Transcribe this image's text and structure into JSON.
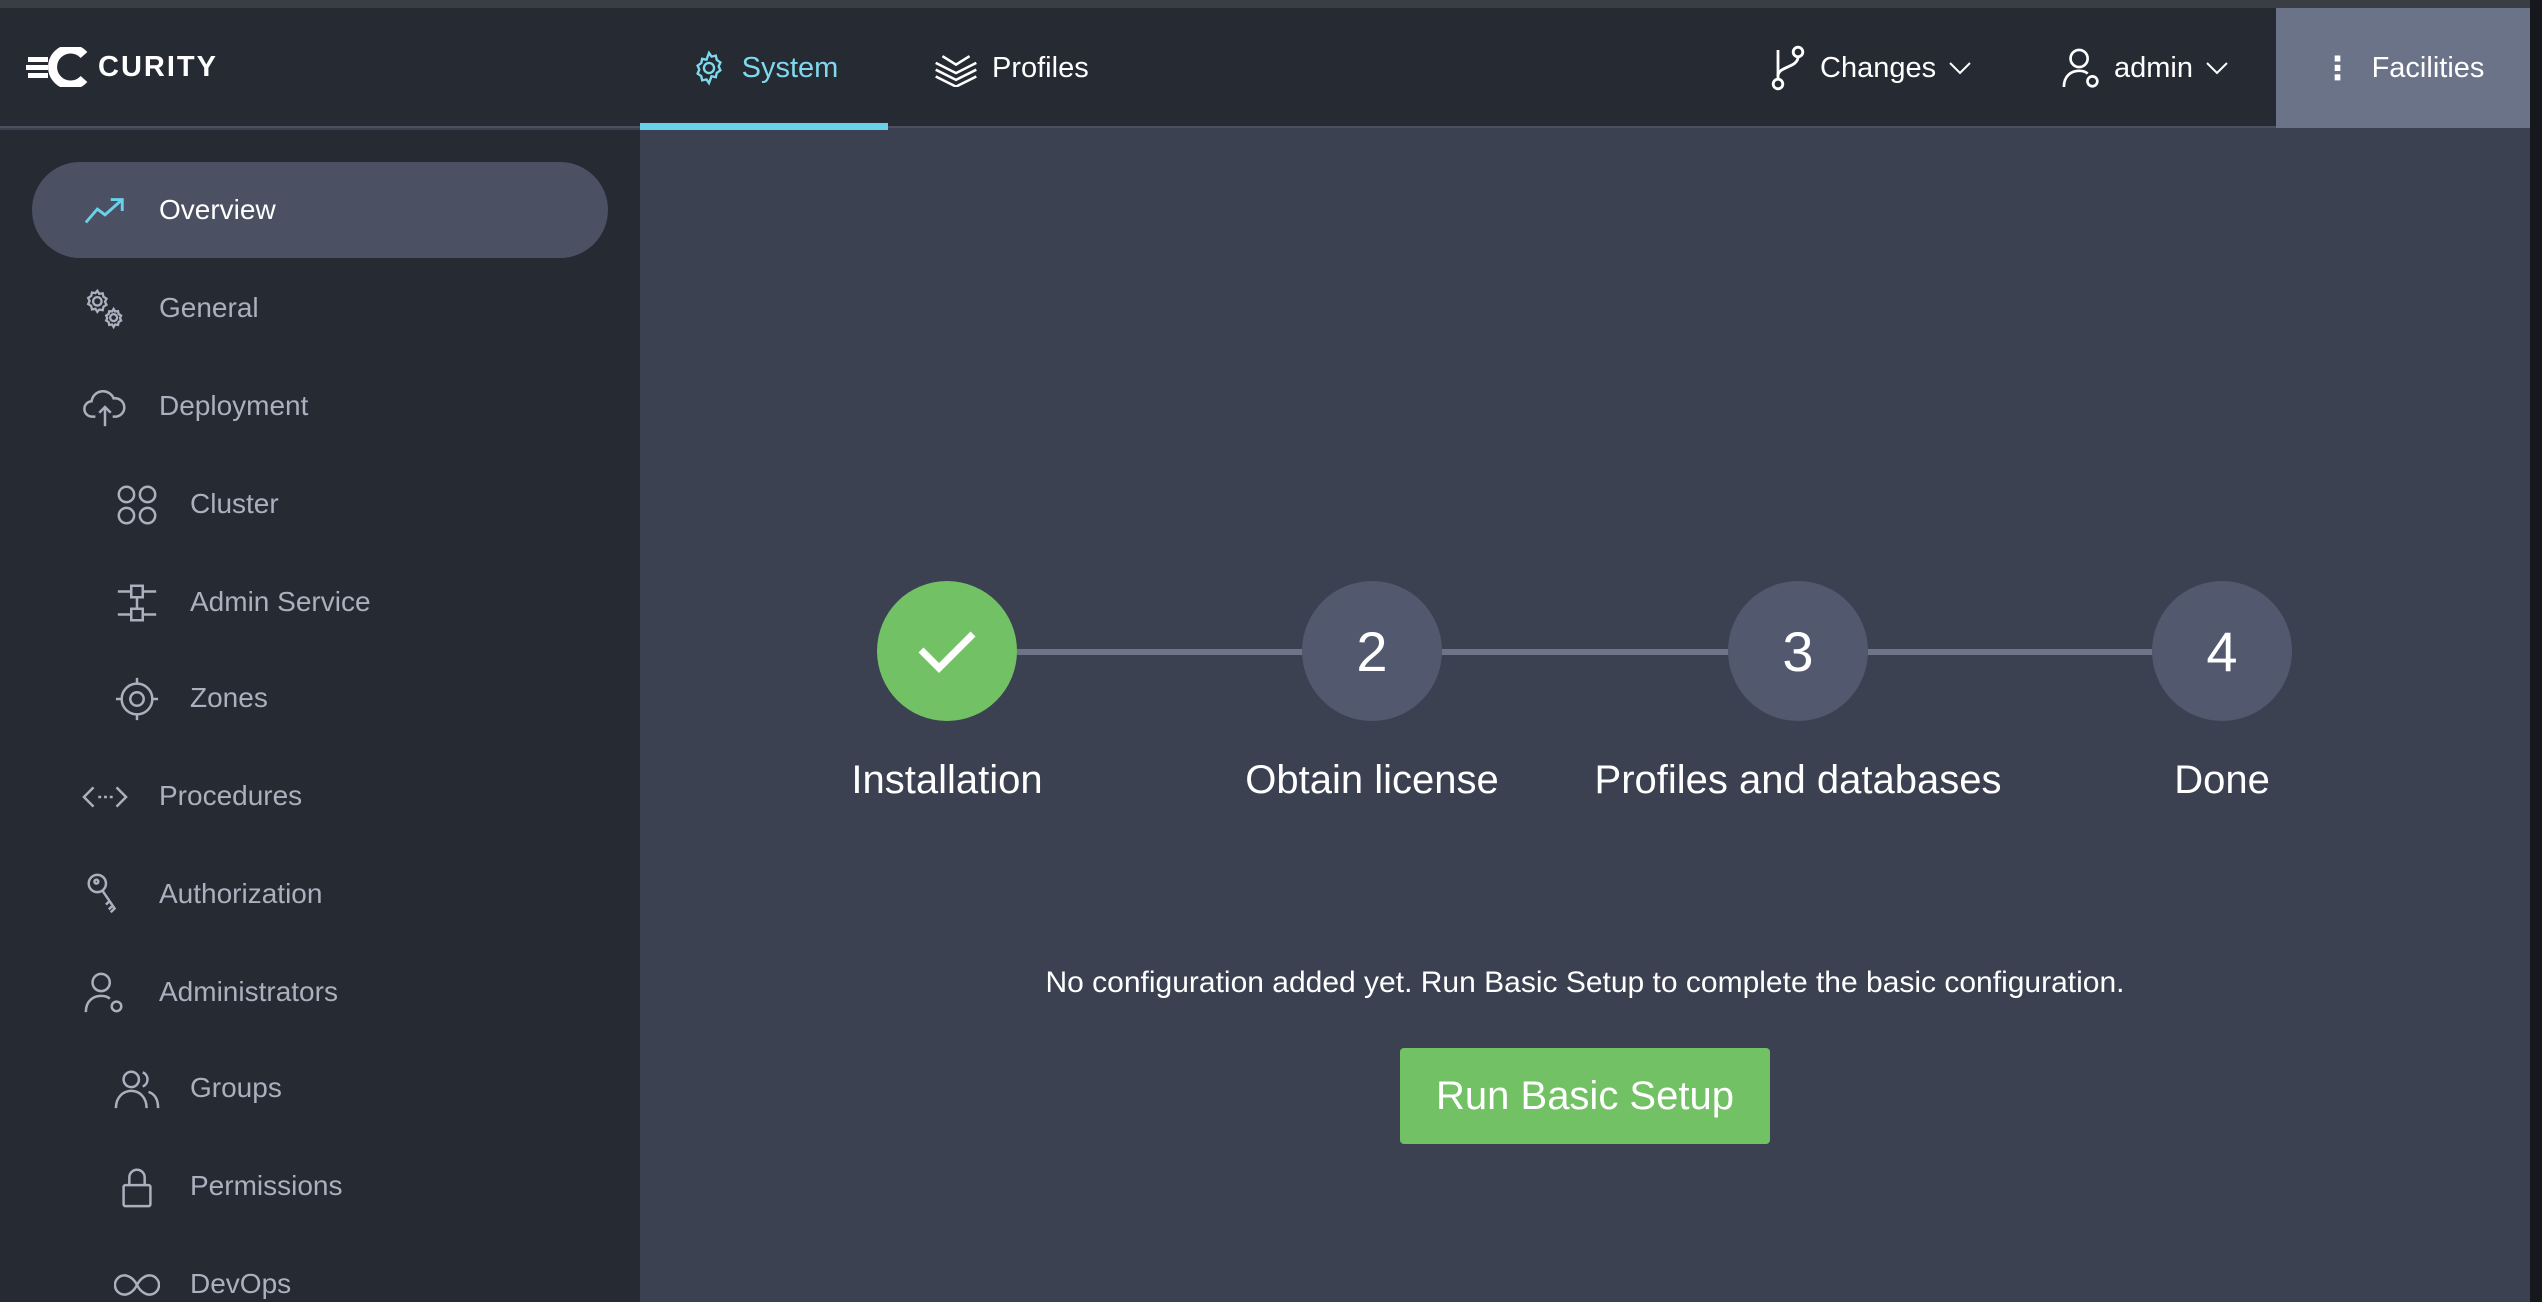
{
  "brand": {
    "name": "CURITY"
  },
  "header": {
    "tabs": [
      {
        "label": "System",
        "icon": "gear-icon",
        "active": true
      },
      {
        "label": "Profiles",
        "icon": "layers-icon",
        "active": false
      }
    ],
    "changes_label": "Changes",
    "user_label": "admin",
    "facilities_label": "Facilities",
    "accent_color": "#69d1e9"
  },
  "sidebar": {
    "items": [
      {
        "label": "Overview",
        "icon": "trend-icon",
        "active": true
      },
      {
        "label": "General",
        "icon": "gears-icon"
      },
      {
        "label": "Deployment",
        "icon": "cloud-upload-icon"
      },
      {
        "label": "Cluster",
        "icon": "cluster-icon"
      },
      {
        "label": "Admin Service",
        "icon": "admin-service-icon"
      },
      {
        "label": "Zones",
        "icon": "target-icon"
      },
      {
        "label": "Procedures",
        "icon": "code-icon"
      },
      {
        "label": "Authorization",
        "icon": "key-icon"
      },
      {
        "label": "Administrators",
        "icon": "user-settings-icon"
      },
      {
        "label": "Groups",
        "icon": "users-icon"
      },
      {
        "label": "Permissions",
        "icon": "lock-icon"
      },
      {
        "label": "DevOps",
        "icon": "infinity-icon"
      }
    ]
  },
  "main": {
    "steps": [
      {
        "number": "",
        "label": "Installation",
        "status": "complete",
        "icon": "check-icon"
      },
      {
        "number": "2",
        "label": "Obtain license",
        "status": "pending"
      },
      {
        "number": "3",
        "label": "Profiles and databases",
        "status": "pending"
      },
      {
        "number": "4",
        "label": "Done",
        "status": "pending"
      }
    ],
    "message": "No configuration added yet. Run Basic Setup to complete the basic configuration.",
    "cta_label": "Run Basic Setup",
    "success_color": "#72c265"
  }
}
